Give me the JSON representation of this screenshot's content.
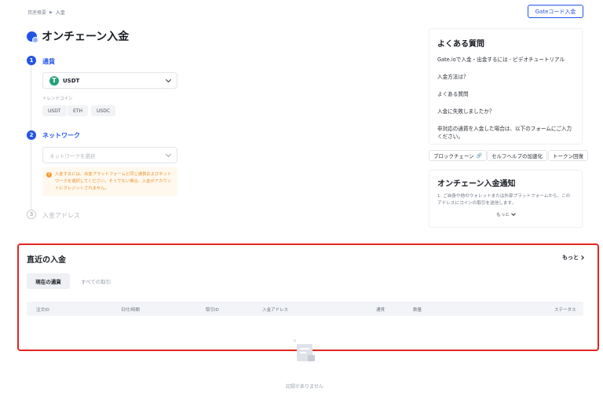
{
  "breadcrumb": {
    "home": "資産概要",
    "separator": "▶",
    "current": "入金"
  },
  "header": {
    "gate_code_button": "Gateコード入金",
    "title": "オンチェーン入金"
  },
  "steps": [
    {
      "num": "1",
      "label": "通貨"
    },
    {
      "num": "2",
      "label": "ネットワーク"
    },
    {
      "num": "3",
      "label": "入金アドレス"
    }
  ],
  "currency": {
    "icon_letter": "T",
    "selected": "USDT",
    "trend_label": "トレンドコイン",
    "trend_coins": [
      "USDT",
      "ETH",
      "USDC"
    ]
  },
  "network": {
    "placeholder": "ネットワークを選択"
  },
  "warning": {
    "icon": "!",
    "text": "入金するには、出金プラットフォームと同じ通貨およびネットワークを選択してください。そうでない場合、入金がアカウントにクレジットされません。"
  },
  "faq": {
    "title": "よくある質問",
    "items": [
      "Gate.ioで入金・出金するには - ビデオチュートリアル",
      "入金方法は？",
      "よくある質問",
      "入金に失敗しましたか？",
      "非対応の通貨を入金した場合は、以下のフォームにご入力ください。"
    ]
  },
  "tags": [
    "ブロックチェーン",
    "セルフヘルプの加速化",
    "トークン回復"
  ],
  "notice": {
    "title": "オンチェーン入金通知",
    "text": "1. ご自身や他のウォレットまたは外部プラットフォームから、このアドレスにコインの取引を送信します。",
    "more": "もっと"
  },
  "recent": {
    "title": "直近の入金",
    "more": "もっと",
    "tab_current": "現在の通貨",
    "tab_all": "すべての取引",
    "columns": [
      "注文ID",
      "日付/時間",
      "取引ID",
      "入金アドレス",
      "通貨",
      "数量",
      "ステータス"
    ],
    "empty": "記録がありません"
  },
  "colors": {
    "accent": "#2354e6",
    "highlight_border": "#e32520",
    "warning": "#e8932a"
  }
}
